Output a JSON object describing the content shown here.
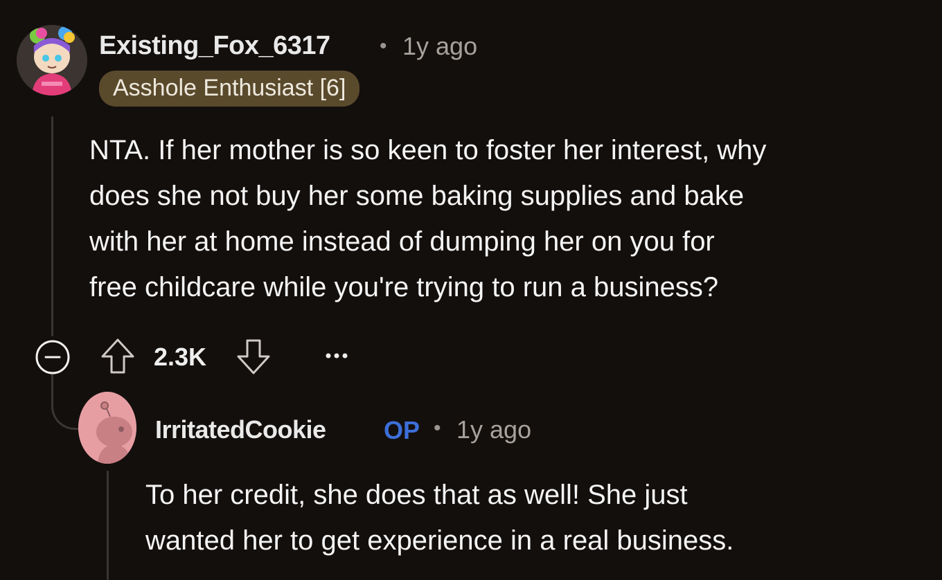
{
  "comment": {
    "username": "Existing_Fox_6317",
    "separator": "•",
    "time": "1y ago",
    "flair": "Asshole Enthusiast [6]",
    "body": "NTA. If her mother is so keen to foster her interest, why does she not buy her some baking supplies and bake with her at home instead of dumping her on you for free childcare while you're trying to run a business?",
    "body_lines": [
      "NTA. If her mother is so keen to foster her interest, why",
      "does she not buy her some baking supplies and bake",
      "with her at home instead of dumping her on you for",
      "free childcare while you're trying to run a business?"
    ],
    "score": "2.3K",
    "more": "•••"
  },
  "reply": {
    "username": "IrritatedCookie",
    "op_badge": "OP",
    "separator": "•",
    "time": "1y ago",
    "body_lines": [
      "To her credit, she does that as well! She just",
      "wanted her to get experience in a real business."
    ]
  },
  "icons": {
    "collapse": "minus-circle-icon",
    "upvote": "arrow-up-icon",
    "downvote": "arrow-down-icon",
    "more": "ellipsis-icon"
  },
  "colors": {
    "background": "#130f0d",
    "flair_bg": "#5a4a2c",
    "op_badge": "#3c6fd8",
    "thread_line": "#3a3633"
  }
}
